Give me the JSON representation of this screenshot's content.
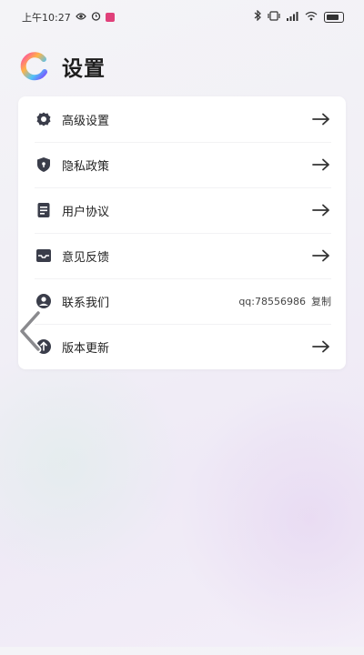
{
  "status_bar": {
    "time": "上午10:27",
    "icons_left": [
      "eye-icon",
      "alarm-icon",
      "app-notification-icon"
    ],
    "icons_right": [
      "bluetooth-icon",
      "vibrate-icon",
      "signal-icon",
      "wifi-icon",
      "battery-icon"
    ]
  },
  "header": {
    "logo": "gradient-ring-logo",
    "title": "设置"
  },
  "menu": {
    "items": [
      {
        "label": "高级设置",
        "icon": "gear-icon"
      },
      {
        "label": "隐私政策",
        "icon": "shield-icon"
      },
      {
        "label": "用户协议",
        "icon": "document-icon"
      },
      {
        "label": "意见反馈",
        "icon": "inbox-icon"
      },
      {
        "label": "联系我们",
        "icon": "contact-icon",
        "value": "qq:78556986",
        "action": "复制"
      },
      {
        "label": "版本更新",
        "icon": "update-icon"
      }
    ]
  },
  "colors": {
    "accent_logo": [
      "#ff4fa0",
      "#ffb347",
      "#4fc3f7",
      "#7c4dff"
    ],
    "text": "#222222",
    "card": "#ffffff"
  }
}
